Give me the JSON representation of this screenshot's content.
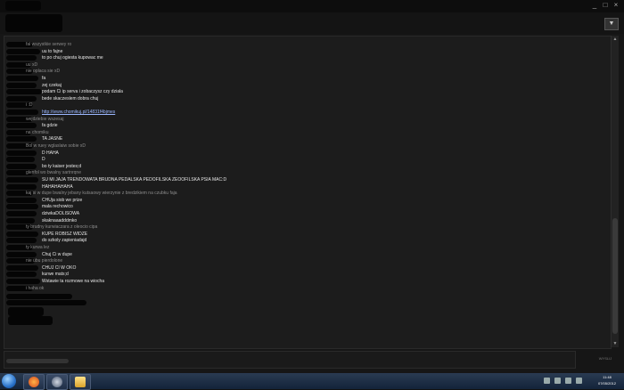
{
  "window": {
    "controls": [
      "_",
      "□",
      "×"
    ]
  },
  "chat": {
    "messages": [
      {
        "kind": "info",
        "text": "fal wszystkie serwey ro"
      },
      {
        "kind": "text",
        "text": "uu to fajne"
      },
      {
        "kind": "text",
        "text": "to po chuj ogiesta kupowac me"
      },
      {
        "kind": "info",
        "text": "uu xD"
      },
      {
        "kind": "info",
        "text": "nie oplaca sie xD"
      },
      {
        "kind": "text",
        "text": "fa"
      },
      {
        "kind": "text",
        "text": "zej czekaj"
      },
      {
        "kind": "text",
        "text": "podam Ci ip serva i zobaczysz czy dziala"
      },
      {
        "kind": "text",
        "text": "bede skaczeslem dobra chuj"
      },
      {
        "kind": "info",
        "text": "i :D"
      },
      {
        "kind": "link",
        "text": "http://www.chomikuj.pl/14831f4bjmes"
      },
      {
        "kind": "info",
        "text": "wejdziebie wszesaj"
      },
      {
        "kind": "text",
        "text": "fa gdzie"
      },
      {
        "kind": "info",
        "text": "na chomiku"
      },
      {
        "kind": "text",
        "text": "TA JASNE"
      },
      {
        "kind": "info",
        "text": "Bol w ruey wglaslaiw sobie xD"
      },
      {
        "kind": "text",
        "text": "D HAHA"
      },
      {
        "kind": "text",
        "text": "D"
      },
      {
        "kind": "text",
        "text": "bo ty kaiser jestes;d"
      },
      {
        "kind": "info",
        "text": "glenfol wo bwalny sartnrqne"
      },
      {
        "kind": "text",
        "text": "SU MI JAJA TRENDOWATA BRUDNA  PEDALSKA PEDOFILSKA ZEOOFILSKA PSIA MAC:D"
      },
      {
        "kind": "text",
        "text": "HAHAHAHAHA"
      },
      {
        "kind": "info",
        "text": "kaj si w dupe bwalny jebany kutsaowy wierzynie z bredzikiem na czubku faja"
      },
      {
        "kind": "text",
        "text": "CHUja siob we prize"
      },
      {
        "kind": "text",
        "text": "mala rechowico"
      },
      {
        "kind": "text",
        "text": "dziwkaDOLISOWA"
      },
      {
        "kind": "text",
        "text": "skaknaaadddmko"
      },
      {
        "kind": "info",
        "text": "ty brudny kurwiaczara z oleocio cipa"
      },
      {
        "kind": "text",
        "text": "KUPE ROBISZ WIDZE"
      },
      {
        "kind": "text",
        "text": "do szkoly zapieniadajd"
      },
      {
        "kind": "info",
        "text": "ty kurwa lez"
      },
      {
        "kind": "text",
        "text": "Chuj Ci w dupe"
      },
      {
        "kind": "info",
        "text": "nie ubu pierdolone"
      },
      {
        "kind": "text",
        "text": "CHUJ CI W OKO"
      },
      {
        "kind": "text",
        "text": "kurwe mats;d"
      },
      {
        "kind": "text",
        "text": "Wstawie ta rozmowe na wiocha"
      },
      {
        "kind": "info",
        "text": "i haha ok"
      }
    ]
  },
  "input": {
    "send_label": "WYSLIJ"
  },
  "taskbar": {
    "clock_time": "11:48",
    "clock_date": "07/05/2012"
  }
}
